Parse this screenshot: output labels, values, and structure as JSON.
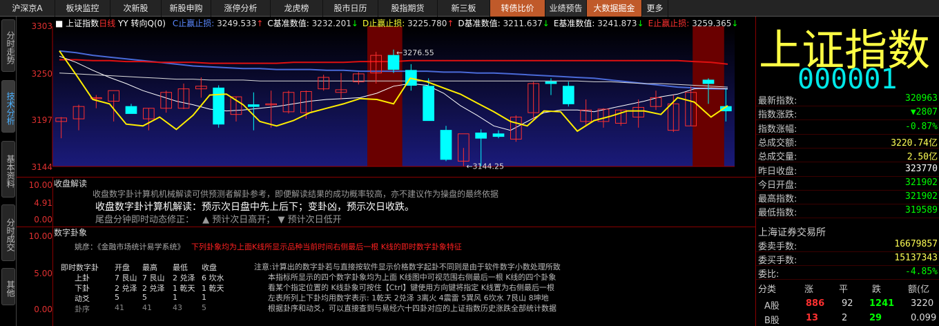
{
  "nav": {
    "tabs": [
      "沪深京A",
      "板块监控",
      "次新股",
      "新股申购",
      "涨停分析",
      "龙虎榜",
      "股市日历",
      "股指期货",
      "新三板",
      "转债比价",
      "业绩预告",
      "大数据掘金",
      "更多"
    ]
  },
  "sidebar": {
    "tabs": [
      "分时走势",
      "技术分析",
      "基本资料",
      "分时成交",
      "其他"
    ]
  },
  "chart": {
    "title": "上证指数",
    "period": "日线",
    "yy": "YY",
    "turn": "转向Q(0)",
    "legend": [
      {
        "label": "C止赢止损:",
        "value": "3249.533",
        "arrow": "↑",
        "color": "#5a88ff"
      },
      {
        "label": "C基准数值:",
        "value": "3232.201",
        "arrow": "↓",
        "color": "#ffffff"
      },
      {
        "label": "D止赢止损:",
        "value": "3225.780",
        "arrow": "↑",
        "color": "#ffff33"
      },
      {
        "label": "D基准数值:",
        "value": "3211.637",
        "arrow": "↓",
        "color": "#ffffff"
      },
      {
        "label": "E基准数值:",
        "value": "3241.873",
        "arrow": "↓",
        "color": "#ffffff"
      },
      {
        "label": "E止赢止损:",
        "value": "3259.365",
        "arrow": "↓",
        "color": "#ff3030"
      }
    ],
    "yticks": [
      "3303",
      "3250",
      "3197",
      "3144"
    ],
    "high_note": "3276.55",
    "low_note": "3144.25",
    "candles": [
      {
        "o": 3195,
        "h": 3200,
        "l": 3176,
        "c": 3199
      },
      {
        "o": 3198,
        "h": 3214,
        "l": 3185,
        "c": 3212
      },
      {
        "o": 3221,
        "h": 3225,
        "l": 3210,
        "c": 3222
      },
      {
        "o": 3218,
        "h": 3226,
        "l": 3195,
        "c": 3230
      },
      {
        "o": 3212,
        "h": 3215,
        "l": 3205,
        "c": 3204
      },
      {
        "o": 3198,
        "h": 3210,
        "l": 3185,
        "c": 3210
      },
      {
        "o": 3210,
        "h": 3230,
        "l": 3205,
        "c": 3228
      },
      {
        "o": 3210,
        "h": 3238,
        "l": 3209,
        "c": 3232
      },
      {
        "o": 3232,
        "h": 3245,
        "l": 3222,
        "c": 3235
      },
      {
        "o": 3233,
        "h": 3236,
        "l": 3188,
        "c": 3192
      },
      {
        "o": 3203,
        "h": 3223,
        "l": 3195,
        "c": 3223
      },
      {
        "o": 3214,
        "h": 3228,
        "l": 3185,
        "c": 3212
      },
      {
        "o": 3214,
        "h": 3230,
        "l": 3188,
        "c": 3215
      },
      {
        "o": 3206,
        "h": 3230,
        "l": 3204,
        "c": 3228
      },
      {
        "o": 3205,
        "h": 3230,
        "l": 3198,
        "c": 3229
      },
      {
        "o": 3232,
        "h": 3248,
        "l": 3230,
        "c": 3245
      },
      {
        "o": 3228,
        "h": 3250,
        "l": 3220,
        "c": 3231
      },
      {
        "o": 3240,
        "h": 3251,
        "l": 3237,
        "c": 3249
      },
      {
        "o": 3250,
        "h": 3274,
        "l": 3238,
        "c": 3270
      },
      {
        "o": 3270,
        "h": 3276.55,
        "l": 3250,
        "c": 3254
      },
      {
        "o": 3253,
        "h": 3260,
        "l": 3230,
        "c": 3236
      },
      {
        "o": 3235,
        "h": 3244,
        "l": 3200,
        "c": 3196
      },
      {
        "o": 3185,
        "h": 3190,
        "l": 3150,
        "c": 3152
      },
      {
        "o": 3150,
        "h": 3165,
        "l": 3144.25,
        "c": 3181
      },
      {
        "o": 3182,
        "h": 3186,
        "l": 3144,
        "c": 3176
      },
      {
        "o": 3181,
        "h": 3185,
        "l": 3176,
        "c": 3178
      },
      {
        "o": 3175,
        "h": 3202,
        "l": 3172,
        "c": 3200
      },
      {
        "o": 3205,
        "h": 3240,
        "l": 3197,
        "c": 3238
      },
      {
        "o": 3240,
        "h": 3244,
        "l": 3225,
        "c": 3238
      },
      {
        "o": 3235,
        "h": 3240,
        "l": 3212,
        "c": 3215
      },
      {
        "o": 3195,
        "h": 3220,
        "l": 3190,
        "c": 3208
      },
      {
        "o": 3195,
        "h": 3210,
        "l": 3188,
        "c": 3209
      },
      {
        "o": 3193,
        "h": 3208,
        "l": 3190,
        "c": 3208
      },
      {
        "o": 3200,
        "h": 3220,
        "l": 3188,
        "c": 3211
      },
      {
        "o": 3212,
        "h": 3230,
        "l": 3208,
        "c": 3222
      },
      {
        "o": 3185,
        "h": 3225,
        "l": 3183,
        "c": 3215
      },
      {
        "o": 3190,
        "h": 3235,
        "l": 3190,
        "c": 3228
      },
      {
        "o": 3242,
        "h": 3244,
        "l": 3215,
        "c": 3238
      },
      {
        "o": 3212,
        "h": 3232,
        "l": 3195,
        "c": 3207
      }
    ],
    "yellow": [
      3275,
      3248,
      3220,
      3215,
      3192,
      3190,
      3200,
      3186,
      3202,
      3225,
      3226,
      3214,
      3195,
      3190,
      3196,
      3205,
      3210,
      3215,
      3221,
      3220,
      3215,
      3244,
      3240,
      3233,
      3226,
      3216,
      3206,
      3195,
      3190,
      3207,
      3206,
      3184,
      3196,
      3201,
      3207,
      3207,
      3203,
      3222,
      3217,
      3200,
      3213
    ],
    "white": [
      3269,
      3262,
      3253,
      3245,
      3238,
      3230,
      3224,
      3218,
      3214,
      3209,
      3207,
      3208,
      3210,
      3212,
      3215,
      3218,
      3220,
      3221,
      3222,
      3227,
      3235,
      3238,
      3236,
      3227,
      3213,
      3202,
      3190,
      3185,
      3195,
      3205,
      3208,
      3208,
      3206,
      3210,
      3214,
      3218,
      3223,
      3226,
      3232,
      3233,
      3232
    ],
    "blue": [
      3275,
      3273,
      3270,
      3268,
      3266,
      3264,
      3262,
      3260,
      3258,
      3257,
      3256,
      3255,
      3255,
      3254,
      3254,
      3254,
      3253,
      3253,
      3252,
      3252,
      3252,
      3252,
      3252,
      3251,
      3251,
      3250,
      3250,
      3249,
      3248,
      3247,
      3246,
      3245,
      3244,
      3242,
      3240,
      3238,
      3236,
      3234,
      3233,
      3232,
      3232
    ],
    "red": [
      3265,
      3265,
      3264,
      3264,
      3263,
      3263,
      3262,
      3262,
      3262,
      3261,
      3261,
      3261,
      3261,
      3261,
      3262,
      3262,
      3262,
      3262,
      3263,
      3263,
      3263,
      3264,
      3264,
      3264,
      3264,
      3264,
      3264,
      3264,
      3264,
      3264,
      3264,
      3264,
      3264,
      3264,
      3264,
      3264,
      3264,
      3264,
      3263,
      3262,
      3260
    ],
    "white2": [
      3250,
      3249,
      3248,
      3247,
      3246,
      3245,
      3244,
      3243,
      3243,
      3242,
      3242,
      3242,
      3241,
      3241,
      3241,
      3241,
      3241,
      3241,
      3241,
      3241,
      3241,
      3241,
      3241,
      3241,
      3241,
      3241,
      3241,
      3241,
      3241,
      3241,
      3241,
      3241,
      3240,
      3240,
      3239,
      3238,
      3238,
      3237,
      3236,
      3235,
      3234
    ],
    "red_bands": [
      {
        "from": 18,
        "to": 19.2
      },
      {
        "from": 36.6,
        "to": 37.6
      }
    ]
  },
  "close_panel": {
    "title": "收盘解读",
    "yticks": [
      "10.00",
      "4.91",
      "0.00"
    ],
    "line1": "收盘数字卦计算机机械解读可供预测者解卦参考，即便解读结果的成功概率较高，亦不建议作为操盘的最终依据",
    "line2": "收盘数字卦计算机解读：预示次日盘中先上后下；变卦凶，预示次日收跌。",
    "line3_a": "尾盘分钟即时动态修正：",
    "line3_b": "▲ 预计次日高开；",
    "line3_c": "▼ 预计次日低开"
  },
  "gua_panel": {
    "title": "数字卦象",
    "yticks": [
      "10.00",
      "5.00",
      "0.00"
    ],
    "yao_label": "姚彦：《金融市场统计易学系统》",
    "yao_red": "下列卦象均为上面K线所显示品种当前时间右侧最后一根 K线的即时数字卦象特征",
    "table": {
      "headers": [
        "即时数字卦",
        "开盘",
        "最高",
        "最低",
        "收盘"
      ],
      "rows": [
        [
          "上卦",
          "7 艮山",
          "7 艮山",
          "2 兑泽",
          "6 坎水"
        ],
        [
          "下卦",
          "2 兑泽",
          "2 兑泽",
          "1 乾天",
          "1 乾天"
        ],
        [
          "动爻",
          "5",
          "5",
          "1",
          "1"
        ],
        [
          "卦序",
          "41",
          "41",
          "43",
          "5"
        ]
      ]
    },
    "notes": [
      "注意:计算出的数字卦若与直接按软件显示价格数字起卦不同则是由于软件数字小数处理所致",
      "本指标所显示的四个数字卦象均为上面 K线图中可视范围右侧最后一根 K线的四个卦象",
      "看某个指定位置的 K线卦象可按住【Ctrl】键使用方向键将指定 K线置为右侧最后一根",
      "左表所列上下卦均用数字表示: 1乾天 2兑泽 3离火 4震雷 5巽风 6坎水 7艮山 8坤地",
      "根据卦序和动爻，可以直接查到与易经六十四卦对应的上证指数历史涨跌全部统计数据"
    ]
  },
  "right_panel": {
    "name": "上证指数",
    "code": "000001",
    "rows": [
      {
        "label": "最新指数:",
        "value": "320963",
        "color": "#00ff00"
      },
      {
        "label": "指数涨跌:",
        "value": "▼2807",
        "color": "#00ff00"
      },
      {
        "label": "指数涨幅:",
        "value": "-0.87%",
        "color": "#00ff00"
      },
      {
        "label": "总成交额:",
        "value": "3220.74亿",
        "color": "#ffff55"
      },
      {
        "label": "总成交量:",
        "value": "2.50亿",
        "color": "#ffff55"
      },
      {
        "label": "昨日收盘:",
        "value": "323770",
        "color": "#ffffff"
      },
      {
        "label": "今日开盘:",
        "value": "321902",
        "color": "#00ff00"
      },
      {
        "label": "最高指数:",
        "value": "321902",
        "color": "#00ff00"
      },
      {
        "label": "最低指数:",
        "value": "319589",
        "color": "#00ff00"
      }
    ],
    "exchange": "上海证券交易所",
    "rows2": [
      {
        "label": "委卖手数:",
        "value": "16679857",
        "color": "#ffff55"
      },
      {
        "label": "委买手数:",
        "value": "15137343",
        "color": "#ffff55"
      },
      {
        "label": "委比:",
        "value": "-4.85%",
        "color": "#00ff00"
      }
    ],
    "table": {
      "headers": [
        "分类",
        "涨",
        "平",
        "跌",
        "额(亿"
      ],
      "rows": [
        {
          "name": "A股",
          "up": "886",
          "flat": "92",
          "down": "1241",
          "amt": "3220"
        },
        {
          "name": "B股",
          "up": "13",
          "flat": "2",
          "down": "29",
          "amt": "0.099"
        }
      ]
    }
  },
  "colors": {
    "up": "#ff3030",
    "down": "#00ffff",
    "bg_chart": "#0a0a5a",
    "accent_tab": "#c05a2a"
  }
}
